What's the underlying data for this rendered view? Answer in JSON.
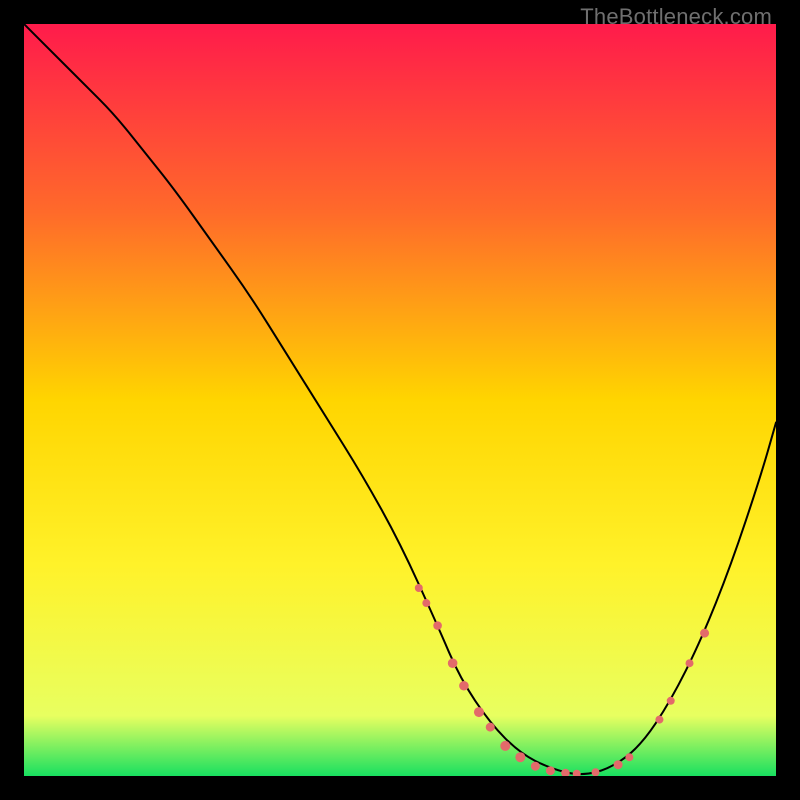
{
  "watermark": "TheBottleneck.com",
  "chart_data": {
    "type": "line",
    "title": "",
    "xlabel": "",
    "ylabel": "",
    "xlim": [
      0,
      100
    ],
    "ylim": [
      0,
      100
    ],
    "grid": false,
    "legend": false,
    "gradient_stops": [
      {
        "offset": 0,
        "color": "#ff1b4b"
      },
      {
        "offset": 0.25,
        "color": "#ff6a2a"
      },
      {
        "offset": 0.5,
        "color": "#ffd500"
      },
      {
        "offset": 0.72,
        "color": "#fff22a"
      },
      {
        "offset": 0.92,
        "color": "#e8ff60"
      },
      {
        "offset": 1.0,
        "color": "#18e060"
      }
    ],
    "series": [
      {
        "name": "bottleneck-curve",
        "x": [
          0,
          4,
          8,
          12,
          16,
          20,
          25,
          30,
          35,
          40,
          45,
          50,
          55,
          58,
          62,
          66,
          70,
          74,
          78,
          82,
          86,
          90,
          94,
          98,
          100
        ],
        "y": [
          100,
          96,
          92,
          88,
          83,
          78,
          71,
          64,
          56,
          48,
          40,
          31,
          20,
          13,
          7,
          3,
          1,
          0,
          1,
          4,
          10,
          18,
          28,
          40,
          47
        ],
        "color": "#000000",
        "stroke_width": 2
      }
    ],
    "markers": [
      {
        "x": 52.5,
        "y": 25,
        "r": 4.0
      },
      {
        "x": 53.5,
        "y": 23,
        "r": 4.0
      },
      {
        "x": 55.0,
        "y": 20,
        "r": 4.3
      },
      {
        "x": 57.0,
        "y": 15,
        "r": 4.8
      },
      {
        "x": 58.5,
        "y": 12,
        "r": 4.8
      },
      {
        "x": 60.5,
        "y": 8.5,
        "r": 5.0
      },
      {
        "x": 62.0,
        "y": 6.5,
        "r": 4.5
      },
      {
        "x": 64.0,
        "y": 4.0,
        "r": 5.0
      },
      {
        "x": 66.0,
        "y": 2.5,
        "r": 5.0
      },
      {
        "x": 68.0,
        "y": 1.3,
        "r": 4.5
      },
      {
        "x": 70.0,
        "y": 0.7,
        "r": 4.5
      },
      {
        "x": 72.0,
        "y": 0.4,
        "r": 4.3
      },
      {
        "x": 73.5,
        "y": 0.3,
        "r": 4.0
      },
      {
        "x": 76.0,
        "y": 0.5,
        "r": 4.0
      },
      {
        "x": 79.0,
        "y": 1.5,
        "r": 4.5
      },
      {
        "x": 80.5,
        "y": 2.5,
        "r": 4.0
      },
      {
        "x": 84.5,
        "y": 7.5,
        "r": 4.0
      },
      {
        "x": 86.0,
        "y": 10.0,
        "r": 4.0
      },
      {
        "x": 88.5,
        "y": 15.0,
        "r": 4.0
      },
      {
        "x": 90.5,
        "y": 19.0,
        "r": 4.5
      }
    ],
    "marker_color": "#e36a6a"
  }
}
